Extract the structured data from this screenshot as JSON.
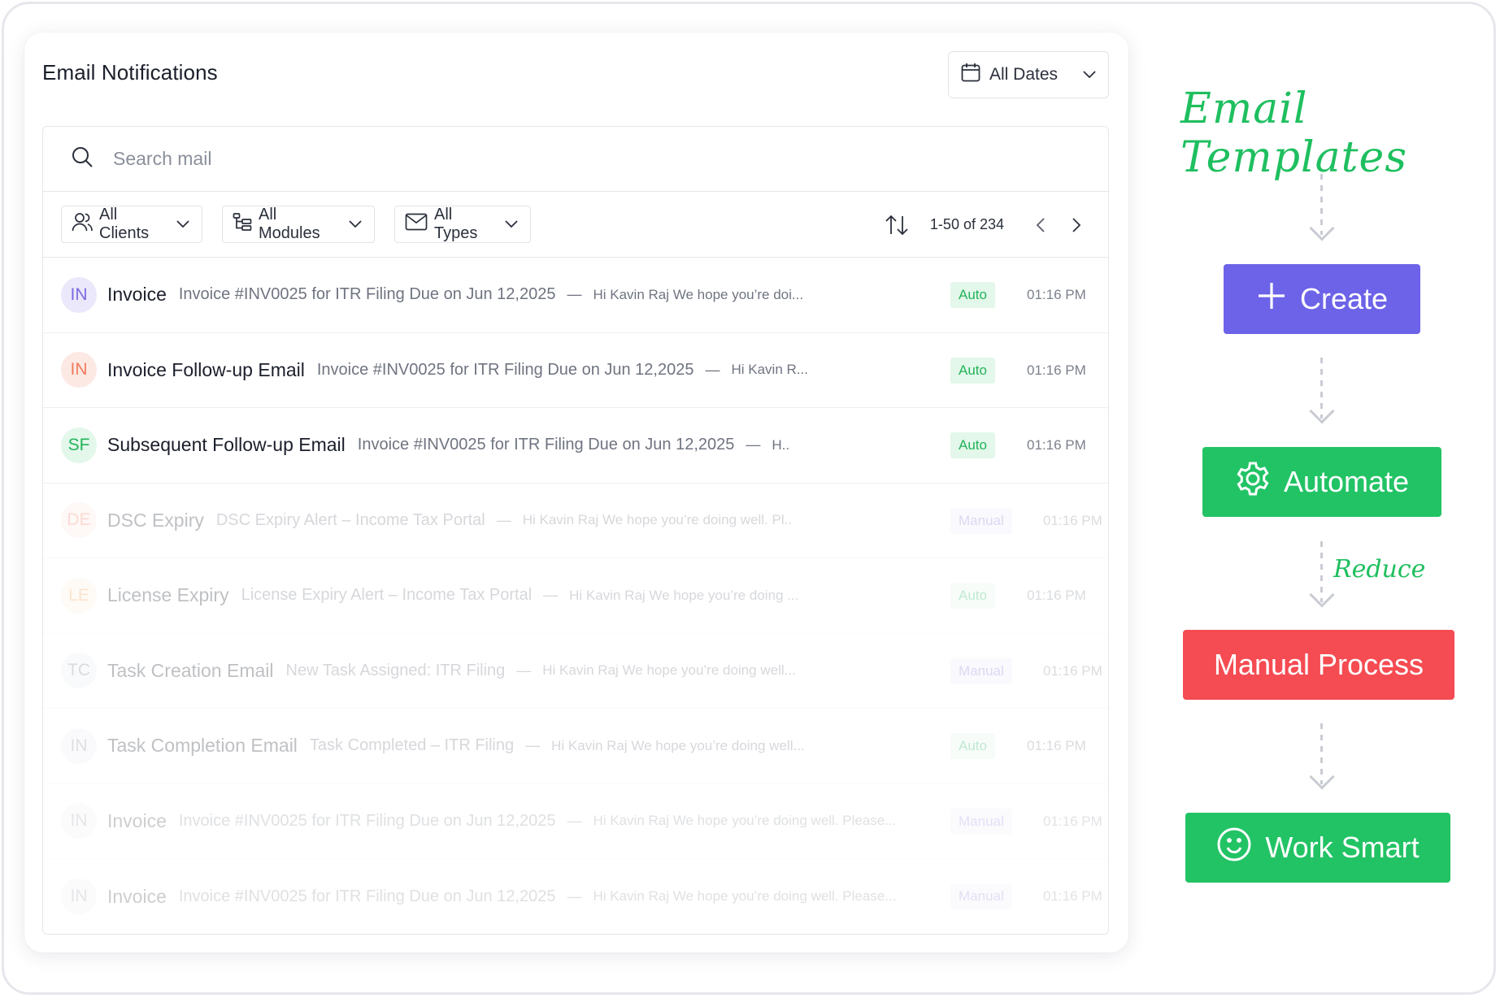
{
  "panel": {
    "title": "Email Notifications",
    "date_filter": "All Dates"
  },
  "search": {
    "placeholder": "Search mail"
  },
  "filters": {
    "clients": "All Clients",
    "modules": "All Modules",
    "types": "All Types"
  },
  "pagination": {
    "range": "1-50 of 234"
  },
  "rows": [
    {
      "initials": "IN",
      "name": "Invoice",
      "subject": "Invoice #INV0025 for ITR Filing Due on Jun 12,2025",
      "dash": "—",
      "preview": "Hi Kavin Raj We hope you’re doi...",
      "badge": "Auto",
      "time": "01:16 PM"
    },
    {
      "initials": "IN",
      "name": "Invoice Follow-up Email",
      "subject": "Invoice #INV0025 for ITR Filing Due on Jun 12,2025",
      "dash": "—",
      "preview": "Hi Kavin R...",
      "badge": "Auto",
      "time": "01:16 PM"
    },
    {
      "initials": "SF",
      "name": "Subsequent Follow-up Email",
      "subject": "Invoice #INV0025 for ITR Filing Due on Jun 12,2025",
      "dash": "—",
      "preview": "H..",
      "badge": "Auto",
      "time": "01:16 PM"
    },
    {
      "initials": "DE",
      "name": "DSC Expiry",
      "subject": "DSC Expiry Alert – Income Tax Portal",
      "dash": "—",
      "preview": "Hi Kavin Raj We hope you’re doing well. Pl..",
      "badge": "Manual",
      "time": "01:16 PM"
    },
    {
      "initials": "LE",
      "name": "License Expiry",
      "subject": "License Expiry Alert – Income Tax Portal",
      "dash": "—",
      "preview": "Hi Kavin Raj We hope you’re doing ...",
      "badge": "Auto",
      "time": "01:16 PM"
    },
    {
      "initials": "TC",
      "name": "Task Creation Email",
      "subject": "New Task Assigned: ITR Filing",
      "dash": "—",
      "preview": "Hi Kavin Raj We hope you’re doing well...",
      "badge": "Manual",
      "time": "01:16 PM"
    },
    {
      "initials": "IN",
      "name": "Task Completion Email",
      "subject": "Task Completed – ITR Filing",
      "dash": "—",
      "preview": "Hi Kavin Raj We hope you’re doing well...",
      "badge": "Auto",
      "time": "01:16 PM"
    },
    {
      "initials": "IN",
      "name": "Invoice",
      "subject": "Invoice #INV0025 for ITR Filing Due on Jun 12,2025",
      "dash": "—",
      "preview": "Hi Kavin Raj We hope you’re doing well. Please...",
      "badge": "Manual",
      "time": "01:16 PM"
    },
    {
      "initials": "IN",
      "name": "Invoice",
      "subject": "Invoice #INV0025 for ITR Filing Due on Jun 12,2025",
      "dash": "—",
      "preview": "Hi Kavin Raj We hope you’re doing well. Please...",
      "badge": "Manual",
      "time": "01:16 PM"
    }
  ],
  "flow": {
    "title": "Email Templates",
    "create": "Create",
    "automate": "Automate",
    "reduce": "Reduce",
    "manual": "Manual Process",
    "work_smart": "Work Smart"
  },
  "colors": {
    "create": "#6c63e8",
    "automate": "#22c365",
    "manual": "#f54b52",
    "work_smart": "#22c365",
    "accent_green": "#1fbf5f"
  }
}
